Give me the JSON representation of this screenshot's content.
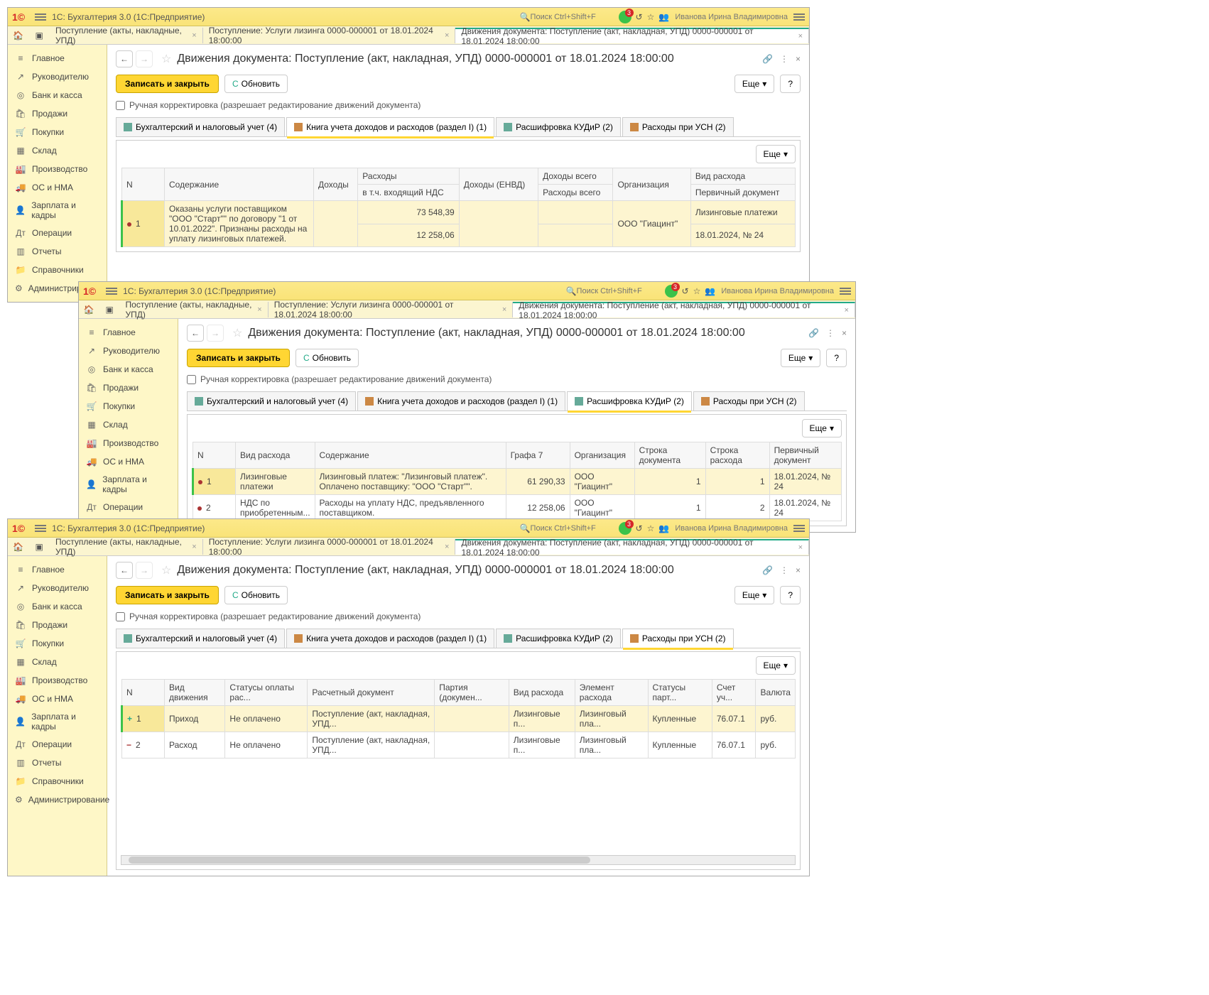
{
  "app": {
    "title": "1С: Бухгалтерия 3.0  (1С:Предприятие)",
    "search_placeholder": "Поиск Ctrl+Shift+F",
    "user": "Иванова Ирина Владимировна"
  },
  "sidebar": {
    "items": [
      {
        "label": "Главное",
        "icon": "≡"
      },
      {
        "label": "Руководителю",
        "icon": "↗"
      },
      {
        "label": "Банк и касса",
        "icon": "◎"
      },
      {
        "label": "Продажи",
        "icon": "🛍"
      },
      {
        "label": "Покупки",
        "icon": "🛒"
      },
      {
        "label": "Склад",
        "icon": "▦"
      },
      {
        "label": "Производство",
        "icon": "🏭"
      },
      {
        "label": "ОС и НМА",
        "icon": "🚚"
      },
      {
        "label": "Зарплата и кадры",
        "icon": "👤"
      },
      {
        "label": "Операции",
        "icon": "Дт"
      },
      {
        "label": "Отчеты",
        "icon": "▥"
      },
      {
        "label": "Справочники",
        "icon": "📁"
      },
      {
        "label": "Администрирование",
        "icon": "⚙"
      }
    ]
  },
  "doc_tabs": [
    {
      "label": "Поступление (акты, накладные, УПД)"
    },
    {
      "label": "Поступление: Услуги лизинга 0000-000001 от 18.01.2024 18:00:00"
    },
    {
      "label": "Движения документа: Поступление (акт, накладная, УПД) 0000-000001 от 18.01.2024 18:00:00",
      "active": true
    }
  ],
  "doc": {
    "title": "Движения документа: Поступление (акт, накладная, УПД) 0000-000001 от 18.01.2024 18:00:00",
    "save_close": "Записать и закрыть",
    "refresh": "Обновить",
    "more": "Еще",
    "help": "?",
    "manual_edit": "Ручная корректировка (разрешает редактирование движений документа)"
  },
  "subtabs": [
    {
      "label": "Бухгалтерский и налоговый учет (4)"
    },
    {
      "label": "Книга учета доходов и расходов (раздел I) (1)"
    },
    {
      "label": "Расшифровка КУДиР (2)"
    },
    {
      "label": "Расходы при УСН (2)"
    }
  ],
  "win1": {
    "headers": [
      "N",
      "Содержание",
      "Доходы",
      "Расходы",
      "Доходы (ЕНВД)",
      "Доходы всего",
      "Организация",
      "Вид расхода"
    ],
    "sub": [
      "",
      "",
      "",
      "в т.ч. входящий НДС",
      "",
      "Расходы всего",
      "",
      "Первичный документ"
    ],
    "row": {
      "n": "1",
      "content": "Оказаны услуги поставщиком \"ООО \"Старт\"\" по договору \"1 от 10.01.2022\". Признаны расходы на уплату лизинговых платежей.",
      "exp": "73 548,39",
      "vat": "12 258,06",
      "org": "ООО \"Гиацинт\"",
      "type": "Лизинговые платежи",
      "prim": "18.01.2024, № 24"
    }
  },
  "win2": {
    "headers": [
      "N",
      "Вид расхода",
      "Содержание",
      "Графа 7",
      "Организация",
      "Строка документа",
      "Строка расхода",
      "Первичный документ"
    ],
    "rows": [
      {
        "n": "1",
        "type": "Лизинговые платежи",
        "content": "Лизинговый платеж: \"Лизинговый платеж\". Оплачено поставщику: \"ООО \"Старт\"\".",
        "g7": "61 290,33",
        "org": "ООО \"Гиацинт\"",
        "docline": "1",
        "expline": "1",
        "prim": "18.01.2024, № 24"
      },
      {
        "n": "2",
        "type": "НДС по приобретенным...",
        "content": "Расходы на уплату НДС, предъявленного поставщиком.",
        "g7": "12 258,06",
        "org": "ООО \"Гиацинт\"",
        "docline": "1",
        "expline": "2",
        "prim": "18.01.2024, № 24"
      }
    ]
  },
  "win3": {
    "headers": [
      "N",
      "Вид движения",
      "Статусы оплаты рас...",
      "Расчетный документ",
      "Партия (докумен...",
      "Вид расхода",
      "Элемент расхода",
      "Статусы парт...",
      "Счет уч...",
      "Валюта"
    ],
    "rows": [
      {
        "n": "1",
        "sign": "+",
        "move": "Приход",
        "pay": "Не оплачено",
        "doc": "Поступление (акт, накладная, УПД...",
        "type": "Лизинговые п...",
        "elem": "Лизинговый пла...",
        "stat": "Купленные",
        "acc": "76.07.1",
        "cur": "руб."
      },
      {
        "n": "2",
        "sign": "−",
        "move": "Расход",
        "pay": "Не оплачено",
        "doc": "Поступление (акт, накладная, УПД...",
        "type": "Лизинговые п...",
        "elem": "Лизинговый пла...",
        "stat": "Купленные",
        "acc": "76.07.1",
        "cur": "руб."
      }
    ]
  }
}
